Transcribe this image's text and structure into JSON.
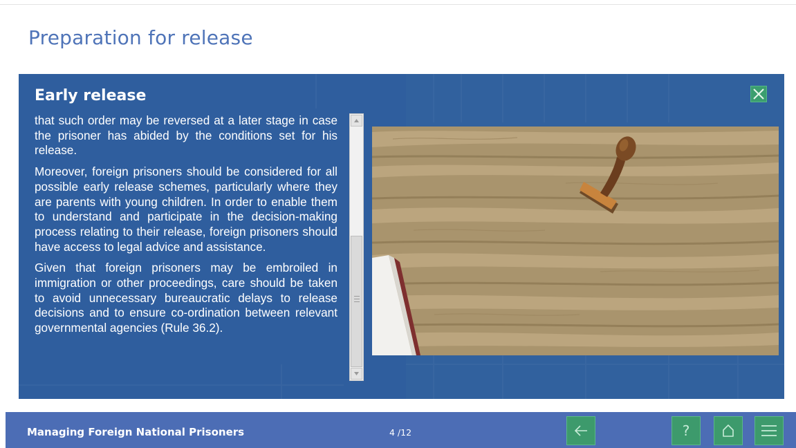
{
  "page": {
    "title": "Preparation for release"
  },
  "panel": {
    "title": "Early release",
    "paragraphs": [
      "that such order may be reversed at a later stage in case the prisoner has abided by the conditions set for his release.",
      "Moreover, foreign prisoners should be considered for all possible early release schemes, particularly where they are parents with young children. In order to enable them to understand and participate in the decision-making process relating to their release, foreign prisoners should have access to legal advice and assistance.",
      "Given that foreign prisoners may be embroiled in immigration or other proceedings, care should be taken to avoid unnecessary bureaucratic delays to release decisions and to ensure co-ordination between relevant governmental agencies (Rule 36.2)."
    ],
    "close_icon": "close-icon",
    "illustration": "wooden-desk-with-rubber-stamp-and-book"
  },
  "footer": {
    "course_title": "Managing Foreign National Prisoners",
    "page_counter": "4 /12",
    "back_icon": "arrow-left-icon",
    "help_label": "?",
    "home_icon": "home-icon",
    "menu_icon": "hamburger-menu-icon"
  },
  "colors": {
    "title_blue": "#4f74b8",
    "panel_blue": "#2f5e9e",
    "footer_blue": "#4c6db5",
    "button_green": "#3d9a6c"
  }
}
